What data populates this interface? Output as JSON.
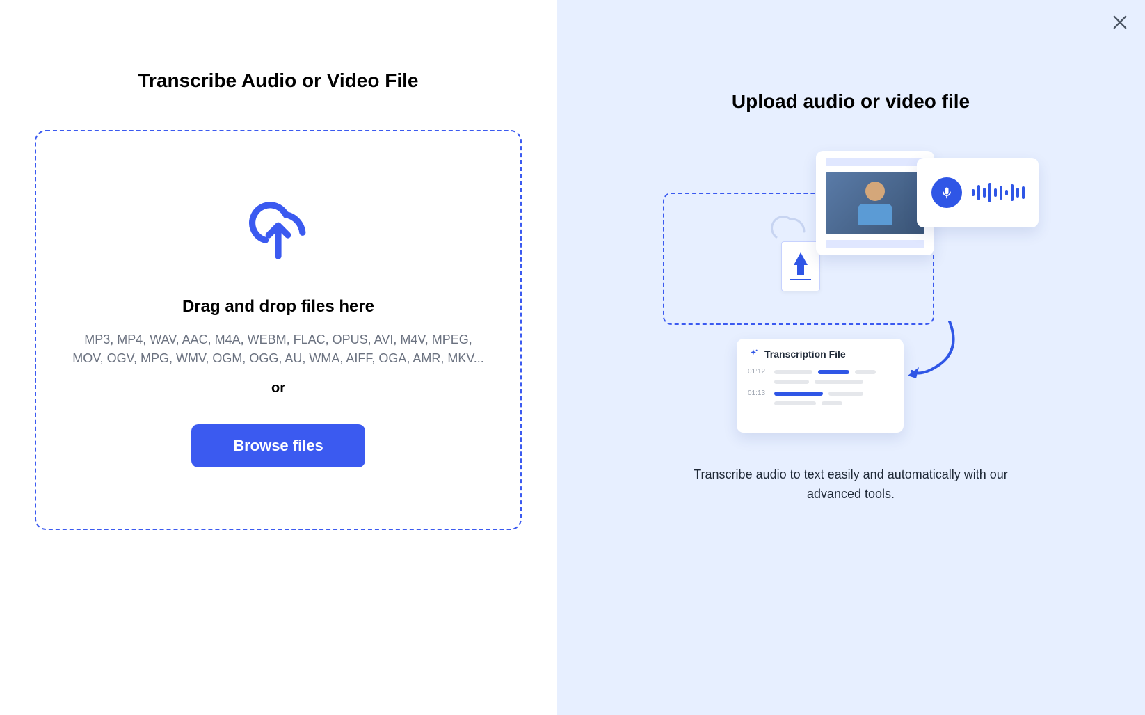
{
  "left": {
    "title": "Transcribe Audio or Video File",
    "drop_title": "Drag and drop files here",
    "formats": "MP3, MP4, WAV, AAC, M4A, WEBM, FLAC, OPUS, AVI, M4V, MPEG, MOV, OGV, MPG, WMV, OGM, OGG, AU, WMA, AIFF, OGA, AMR, MKV...",
    "or": "or",
    "browse_label": "Browse files"
  },
  "right": {
    "title": "Upload audio or video file",
    "transcription_label": "Transcription File",
    "timestamps": [
      "01:12",
      "01:13"
    ],
    "description": "Transcribe audio to text easily and automatically with our advanced tools."
  }
}
